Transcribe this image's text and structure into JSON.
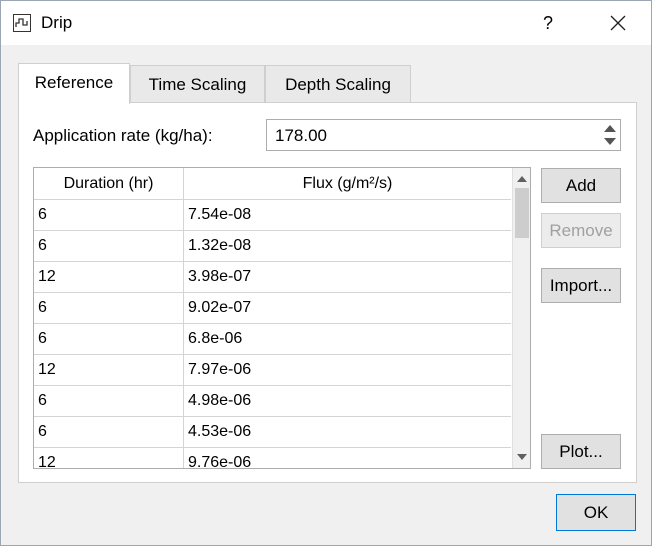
{
  "window": {
    "title": "Drip",
    "help_label": "?",
    "app_icon": "chart-window-icon",
    "close_icon": "close-icon"
  },
  "tabs": [
    {
      "label": "Reference",
      "active": true
    },
    {
      "label": "Time Scaling",
      "active": false
    },
    {
      "label": "Depth Scaling",
      "active": false
    }
  ],
  "rate": {
    "label": "Application rate (kg/ha):",
    "value": "178.00"
  },
  "table": {
    "headers": [
      "Duration (hr)",
      "Flux (g/m²/s)"
    ],
    "rows": [
      [
        "6",
        "7.54e-08"
      ],
      [
        "6",
        "1.32e-08"
      ],
      [
        "12",
        "3.98e-07"
      ],
      [
        "6",
        "9.02e-07"
      ],
      [
        "6",
        "6.8e-06"
      ],
      [
        "12",
        "7.97e-06"
      ],
      [
        "6",
        "4.98e-06"
      ],
      [
        "6",
        "4.53e-06"
      ],
      [
        "12",
        "9.76e-06"
      ]
    ]
  },
  "buttons": {
    "add": "Add",
    "remove": "Remove",
    "import": "Import...",
    "plot": "Plot...",
    "ok": "OK"
  },
  "colors": {
    "accent": "#0078d7",
    "disabled_text": "#a0a0a0"
  }
}
